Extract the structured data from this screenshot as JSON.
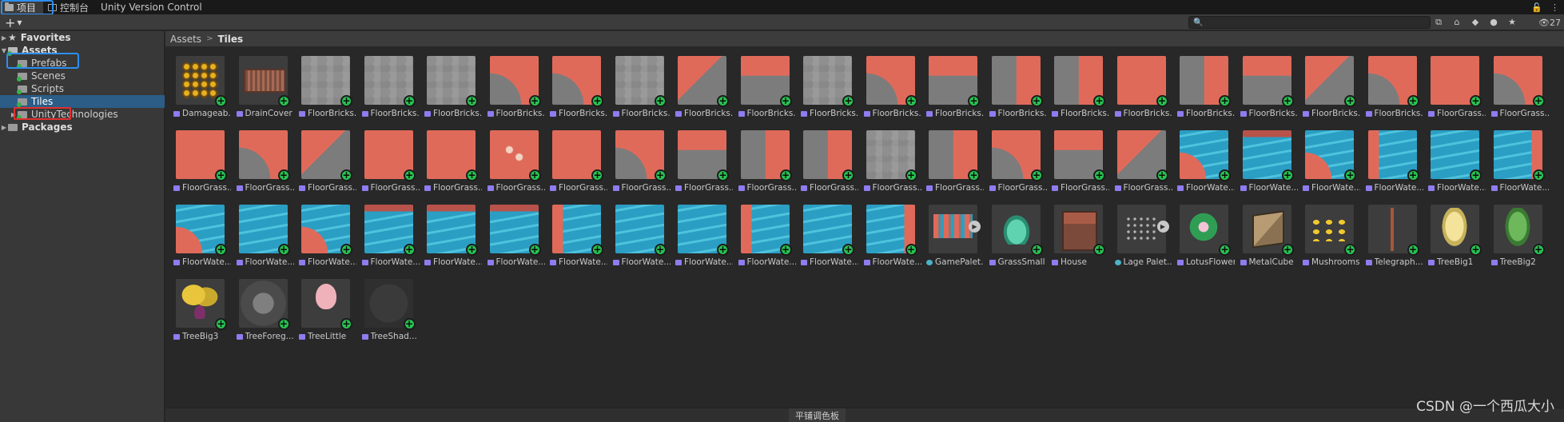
{
  "tabs": [
    {
      "label": "项目"
    },
    {
      "label": "控制台"
    },
    {
      "label": "Unity Version Control"
    }
  ],
  "toolbar": {
    "add_label": "+",
    "search_placeholder": "",
    "visible_count": "27"
  },
  "tree": {
    "favorites": "Favorites",
    "assets": "Assets",
    "prefabs": "Prefabs",
    "scenes": "Scenes",
    "scripts": "Scripts",
    "tiles": "Tiles",
    "unity_technologies": "UnityTechnologies",
    "packages": "Packages"
  },
  "breadcrumb": {
    "root": "Assets",
    "current": "Tiles"
  },
  "grid": [
    [
      {
        "label": "Damageab...",
        "kind": "damage"
      },
      {
        "label": "DrainCover",
        "kind": "drain"
      },
      {
        "label": "FloorBricks...",
        "kind": "cobble"
      },
      {
        "label": "FloorBricks...",
        "kind": "cobble"
      },
      {
        "label": "FloorBricks...",
        "kind": "cobble"
      },
      {
        "label": "FloorBricks...",
        "kind": "mixD"
      },
      {
        "label": "FloorBricks...",
        "kind": "mixD"
      },
      {
        "label": "FloorBricks...",
        "kind": "cobble"
      },
      {
        "label": "FloorBricks...",
        "kind": "mixA"
      },
      {
        "label": "FloorBricks...",
        "kind": "mixC"
      },
      {
        "label": "FloorBricks...",
        "kind": "cobble"
      },
      {
        "label": "FloorBricks...",
        "kind": "mixD"
      },
      {
        "label": "FloorBricks...",
        "kind": "mixC"
      },
      {
        "label": "FloorBricks...",
        "kind": "mixB"
      },
      {
        "label": "FloorBricks...",
        "kind": "mixB"
      },
      {
        "label": "FloorBricks...",
        "kind": "grass"
      },
      {
        "label": "FloorBricks...",
        "kind": "mixB"
      },
      {
        "label": "FloorBricks...",
        "kind": "mixC"
      },
      {
        "label": "FloorBricks...",
        "kind": "mixA"
      },
      {
        "label": "FloorBricks...",
        "kind": "mixD"
      },
      {
        "label": "FloorGrass...",
        "kind": "grass"
      },
      {
        "label": "FloorGrass...",
        "kind": "mixD"
      }
    ],
    [
      {
        "label": "FloorGrass...",
        "kind": "grass"
      },
      {
        "label": "FloorGrass...",
        "kind": "mixD"
      },
      {
        "label": "FloorGrass...",
        "kind": "mixA"
      },
      {
        "label": "FloorGrass...",
        "kind": "grass"
      },
      {
        "label": "FloorGrass...",
        "kind": "grass"
      },
      {
        "label": "FloorGrass...",
        "kind": "flower"
      },
      {
        "label": "FloorGrass...",
        "kind": "flow"
      },
      {
        "label": "FloorGrass...",
        "kind": "mixD"
      },
      {
        "label": "FloorGrass...",
        "kind": "mixC"
      },
      {
        "label": "FloorGrass...",
        "kind": "mixB"
      },
      {
        "label": "FloorGrass...",
        "kind": "mixB"
      },
      {
        "label": "FloorGrass...",
        "kind": "cobble"
      },
      {
        "label": "FloorGrass...",
        "kind": "mixB"
      },
      {
        "label": "FloorGrass...",
        "kind": "mixD"
      },
      {
        "label": "FloorGrass...",
        "kind": "mixC"
      },
      {
        "label": "FloorGrass...",
        "kind": "mixA"
      },
      {
        "label": "FloorWate...",
        "kind": "waterC"
      },
      {
        "label": "FloorWate...",
        "kind": "waterE"
      },
      {
        "label": "FloorWate...",
        "kind": "waterC"
      },
      {
        "label": "FloorWate...",
        "kind": "waterL"
      },
      {
        "label": "FloorWate...",
        "kind": "water"
      },
      {
        "label": "FloorWate...",
        "kind": "waterR"
      }
    ],
    [
      {
        "label": "FloorWate...",
        "kind": "waterC"
      },
      {
        "label": "FloorWate...",
        "kind": "water"
      },
      {
        "label": "FloorWate...",
        "kind": "waterC"
      },
      {
        "label": "FloorWate...",
        "kind": "waterE"
      },
      {
        "label": "FloorWate...",
        "kind": "waterE"
      },
      {
        "label": "FloorWate...",
        "kind": "waterE"
      },
      {
        "label": "FloorWate...",
        "kind": "waterL"
      },
      {
        "label": "FloorWate...",
        "kind": "water"
      },
      {
        "label": "FloorWate...",
        "kind": "water"
      },
      {
        "label": "FloorWate...",
        "kind": "waterL"
      },
      {
        "label": "FloorWate...",
        "kind": "water"
      },
      {
        "label": "FloorWate...",
        "kind": "waterR"
      },
      {
        "label": "GamePalet...",
        "kind": "palette",
        "palette": true
      },
      {
        "label": "GrassSmall",
        "kind": "grassSmall"
      },
      {
        "label": "House",
        "kind": "house"
      },
      {
        "label": "Lage Palet...",
        "kind": "palette2",
        "palette": true
      },
      {
        "label": "LotusFlower",
        "kind": "lotus"
      },
      {
        "label": "MetalCube",
        "kind": "cube"
      },
      {
        "label": "Mushrooms",
        "kind": "mush"
      },
      {
        "label": "Telegraph...",
        "kind": "tele"
      },
      {
        "label": "TreeBig1",
        "kind": "tree1"
      },
      {
        "label": "TreeBig2",
        "kind": "tree2"
      }
    ],
    [
      {
        "label": "TreeBig3",
        "kind": "tree3"
      },
      {
        "label": "TreeForeg...",
        "kind": "treeF"
      },
      {
        "label": "TreeLittle",
        "kind": "treeL"
      },
      {
        "label": "TreeShad...",
        "kind": "treeS"
      }
    ]
  ],
  "status": {
    "text": "平铺调色板"
  },
  "watermark": "CSDN @一个西瓜大小",
  "colors": {
    "accent_blue": "#2d8ff0",
    "highlight_red": "#e0312f",
    "add_badge": "#27c251",
    "selection": "#2c5d87"
  }
}
